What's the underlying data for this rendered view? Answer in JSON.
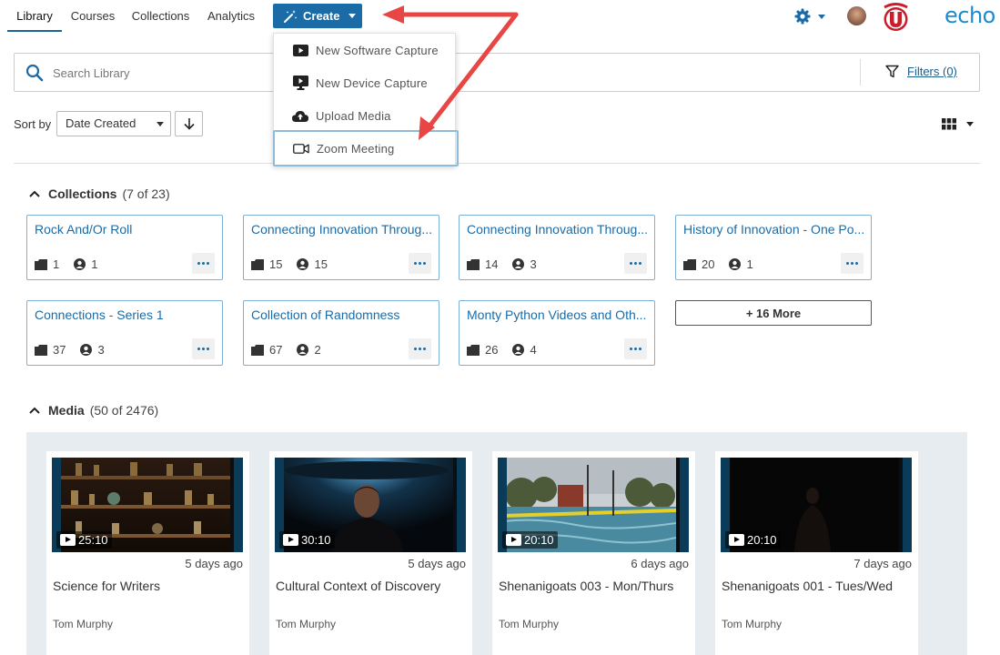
{
  "nav": {
    "tabs": [
      {
        "label": "Library",
        "active": true
      },
      {
        "label": "Courses"
      },
      {
        "label": "Collections"
      },
      {
        "label": "Analytics"
      }
    ],
    "create_label": "Create",
    "logo_text": "echo",
    "brand_color": "#1b6ba6"
  },
  "create_menu": {
    "items": [
      {
        "label": "New Software Capture",
        "icon": "video-play-icon"
      },
      {
        "label": "New Device Capture",
        "icon": "monitor-play-icon"
      },
      {
        "label": "Upload Media",
        "icon": "cloud-upload-icon"
      },
      {
        "label": "Zoom Meeting",
        "icon": "video-camera-icon",
        "highlighted": true
      }
    ]
  },
  "search": {
    "placeholder": "Search Library",
    "value": "",
    "filters_label": "Filters (0)"
  },
  "sort": {
    "label": "Sort by",
    "selected": "Date Created"
  },
  "collections": {
    "title": "Collections",
    "count": "(7 of 23)",
    "items": [
      {
        "title": "Rock And/Or Roll",
        "media": "1",
        "users": "1"
      },
      {
        "title": "Connecting Innovation Throug...",
        "media": "15",
        "users": "15"
      },
      {
        "title": "Connecting Innovation Throug...",
        "media": "14",
        "users": "3"
      },
      {
        "title": "History of Innovation - One Po...",
        "media": "20",
        "users": "1"
      },
      {
        "title": "Connections - Series 1",
        "media": "37",
        "users": "3"
      },
      {
        "title": "Collection of Randomness",
        "media": "67",
        "users": "2"
      },
      {
        "title": "Monty Python Videos and Oth...",
        "media": "26",
        "users": "4"
      }
    ],
    "more_label": "+ 16 More"
  },
  "media": {
    "title": "Media",
    "count": "(50 of 2476)",
    "items": [
      {
        "title": "Science for Writers",
        "duration": "25:10",
        "ago": "5 days ago",
        "author": "Tom Murphy"
      },
      {
        "title": "Cultural Context of Discovery",
        "duration": "30:10",
        "ago": "5 days ago",
        "author": "Tom Murphy"
      },
      {
        "title": "Shenanigoats 003 - Mon/Thurs",
        "duration": "20:10",
        "ago": "6 days ago",
        "author": "Tom Murphy"
      },
      {
        "title": "Shenanigoats 001 - Tues/Wed",
        "duration": "20:10",
        "ago": "7 days ago",
        "author": "Tom Murphy"
      }
    ]
  }
}
